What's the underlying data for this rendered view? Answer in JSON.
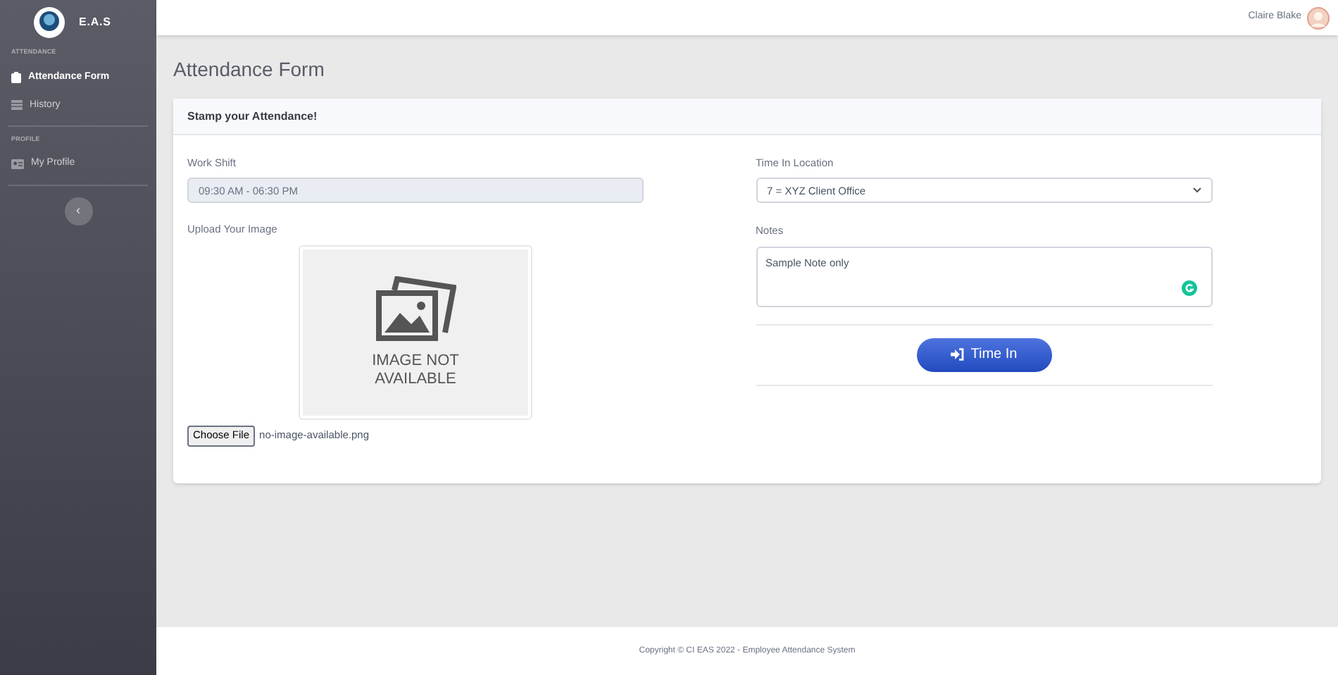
{
  "sidebar": {
    "brand": "E.A.S",
    "sections": [
      {
        "heading": "ATTENDANCE",
        "items": [
          {
            "label": "Attendance Form",
            "kind": "clipboard",
            "selected": true
          },
          {
            "label": "History",
            "kind": "table",
            "selected": false
          }
        ]
      },
      {
        "heading": "PROFILE",
        "items": [
          {
            "label": "My Profile",
            "kind": "card",
            "selected": false
          }
        ]
      }
    ],
    "toggle": "‹"
  },
  "topbar": {
    "user_name": "Claire Blake"
  },
  "page_title": "Attendance Form",
  "card": {
    "header": "Stamp your Attendance!",
    "work_shift": {
      "label": "Work Shift",
      "value": "09:30 AM - 06:30 PM"
    },
    "upload": {
      "label": "Upload Your Image",
      "preview_caption": [
        "IMAGE NOT",
        "AVAILABLE"
      ],
      "button": "Choose File",
      "file_name": "no-image-available.png"
    },
    "location": {
      "label": "Time In Location",
      "value": "7 = XYZ Client Office"
    },
    "notes": {
      "label": "Notes",
      "value": "Sample Note only"
    },
    "submit": "Time In"
  },
  "footer": "Copyright © CI EAS 2022 - Employee Attendance System"
}
